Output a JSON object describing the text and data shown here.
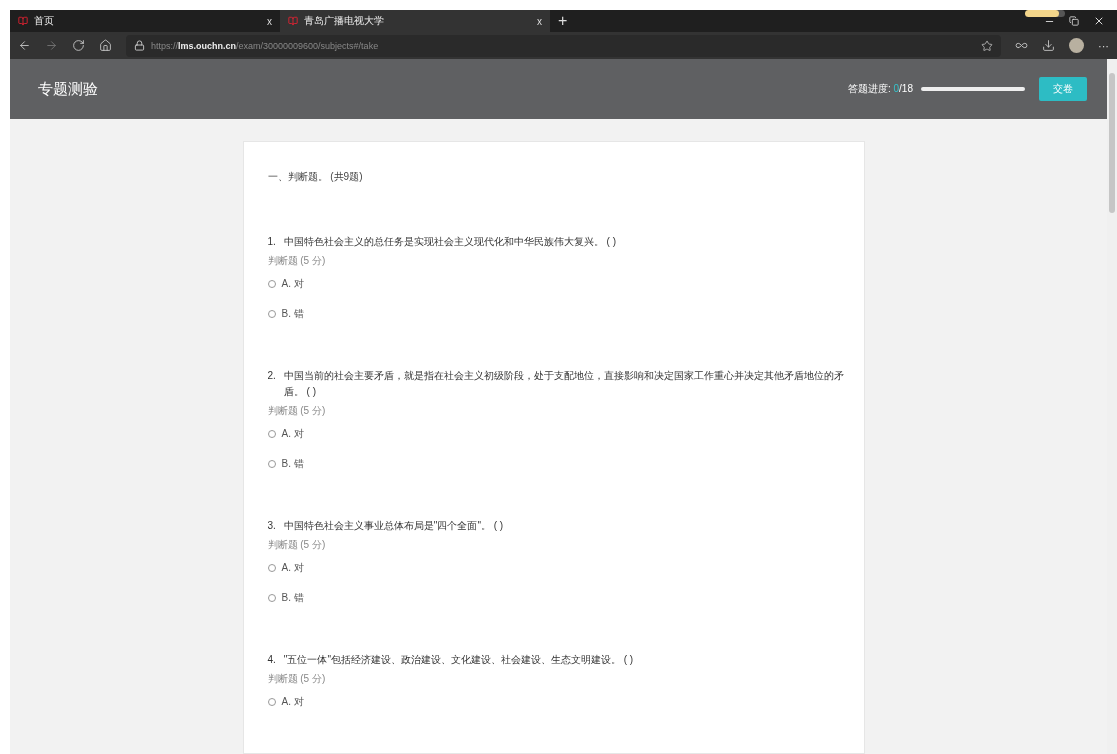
{
  "browser": {
    "tabs": [
      {
        "title": "首页",
        "selected": false,
        "close": "x"
      },
      {
        "title": "青岛广播电视大学",
        "selected": true,
        "close": "x"
      }
    ],
    "new_tab": "+",
    "address": "https://**lms.ouchn.cn**/exam/30000009600/subjects#/take",
    "more": "···"
  },
  "header": {
    "title": "专题测验",
    "progress": {
      "label": "答题进度: ",
      "answered": "0",
      "total": "/18",
      "level": 0
    },
    "submit": "交卷"
  },
  "section": {
    "title": "一、判断题。 (共9题)",
    "questions": [
      {
        "number": "1.",
        "text": "中国特色社会主义的总任务是实现社会主义现代化和中华民族伟大复兴。 ( )",
        "type": "判断题 (5 分)",
        "options": [
          {
            "label": "A. 对",
            "selected": false
          },
          {
            "label": "B. 错",
            "selected": false
          }
        ]
      },
      {
        "number": "2.",
        "text": "中国当前的社会主要矛盾，就是指在社会主义初级阶段，处于支配地位，直接影响和决定国家工作重心并决定其他矛盾地位的矛盾。 ( )",
        "type": "判断题 (5 分)",
        "options": [
          {
            "label": "A. 对",
            "selected": false
          },
          {
            "label": "B. 错",
            "selected": false
          }
        ]
      },
      {
        "number": "3.",
        "text": "中国特色社会主义事业总体布局是\"四个全面\"。 ( )",
        "type": "判断题 (5 分)",
        "options": [
          {
            "label": "A. 对",
            "selected": false
          },
          {
            "label": "B. 错",
            "selected": false
          }
        ]
      },
      {
        "number": "4.",
        "text": "\"五位一体\"包括经济建设、政治建设、文化建设、社会建设、生态文明建设。 ( )",
        "type": "判断题 (5 分)",
        "options": [
          {
            "label": "A. 对",
            "selected": false
          }
        ]
      }
    ]
  }
}
